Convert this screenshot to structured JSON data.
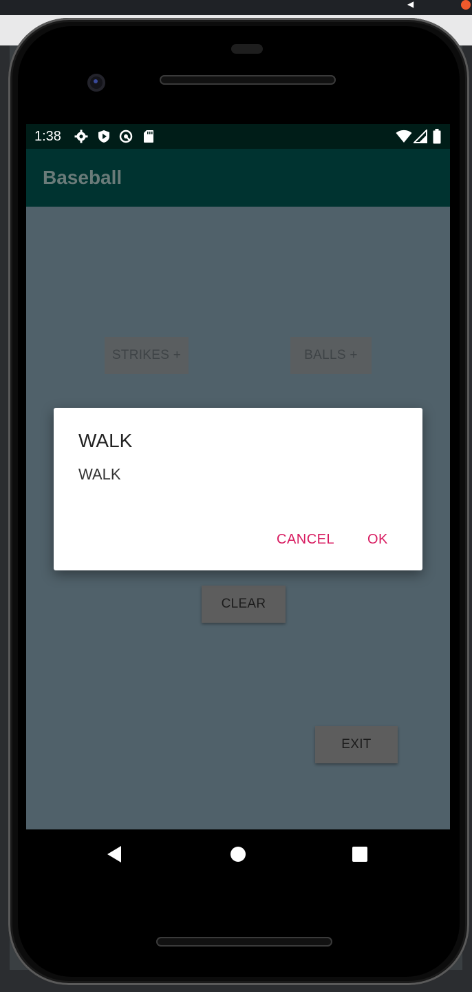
{
  "status": {
    "time": "1:38"
  },
  "app": {
    "title": "Baseball"
  },
  "buttons": {
    "strikes_label": "STRIKES +",
    "balls_label": "BALLS +",
    "clear_label": "CLEAR",
    "exit_label": "EXIT"
  },
  "dialog": {
    "title": "WALK",
    "message": "WALK",
    "cancel_label": "CANCEL",
    "ok_label": "OK"
  },
  "colors": {
    "accent": "#d81b60",
    "appbar": "#003330",
    "statusbar": "#001d18",
    "screen_dim": "#50616a"
  },
  "icons": {
    "status_left": [
      "settings-icon",
      "play-protect-icon",
      "vpn-icon",
      "sd-card-icon"
    ],
    "status_right": [
      "wifi-icon",
      "cell-signal-icon",
      "battery-icon"
    ],
    "nav": [
      "back-icon",
      "home-icon",
      "recents-icon"
    ]
  }
}
